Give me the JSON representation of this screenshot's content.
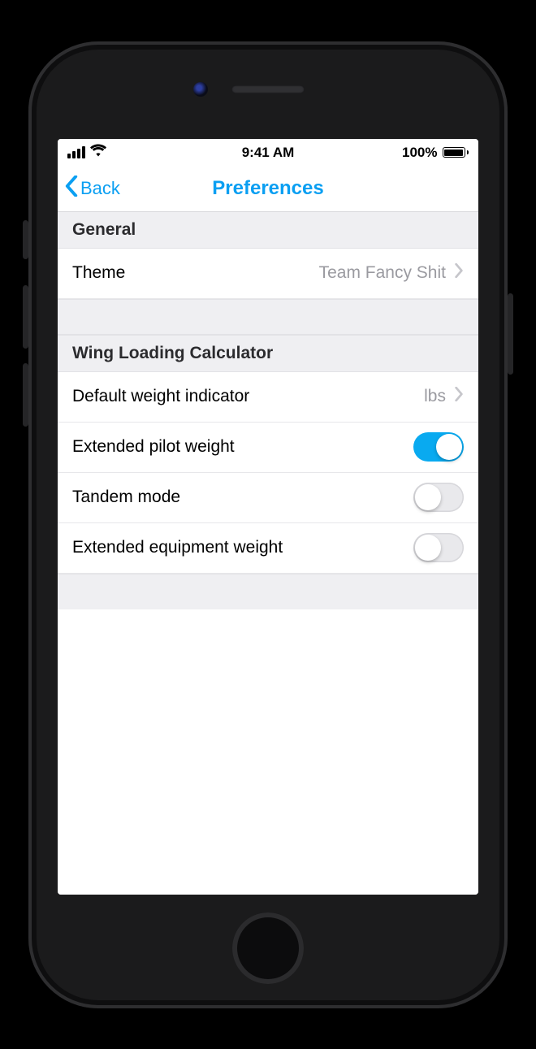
{
  "status_bar": {
    "time": "9:41 AM",
    "battery_pct": "100%"
  },
  "nav": {
    "back_label": "Back",
    "title": "Preferences"
  },
  "colors": {
    "accent": "#0a9ff2"
  },
  "sections": [
    {
      "header": "General",
      "rows": [
        {
          "kind": "disclosure",
          "label": "Theme",
          "value": "Team Fancy Shit"
        }
      ]
    },
    {
      "header": "Wing Loading Calculator",
      "rows": [
        {
          "kind": "disclosure",
          "label": "Default weight indicator",
          "value": "lbs"
        },
        {
          "kind": "switch",
          "label": "Extended pilot weight",
          "on": true
        },
        {
          "kind": "switch",
          "label": "Tandem mode",
          "on": false
        },
        {
          "kind": "switch",
          "label": "Extended equipment weight",
          "on": false
        }
      ]
    }
  ]
}
